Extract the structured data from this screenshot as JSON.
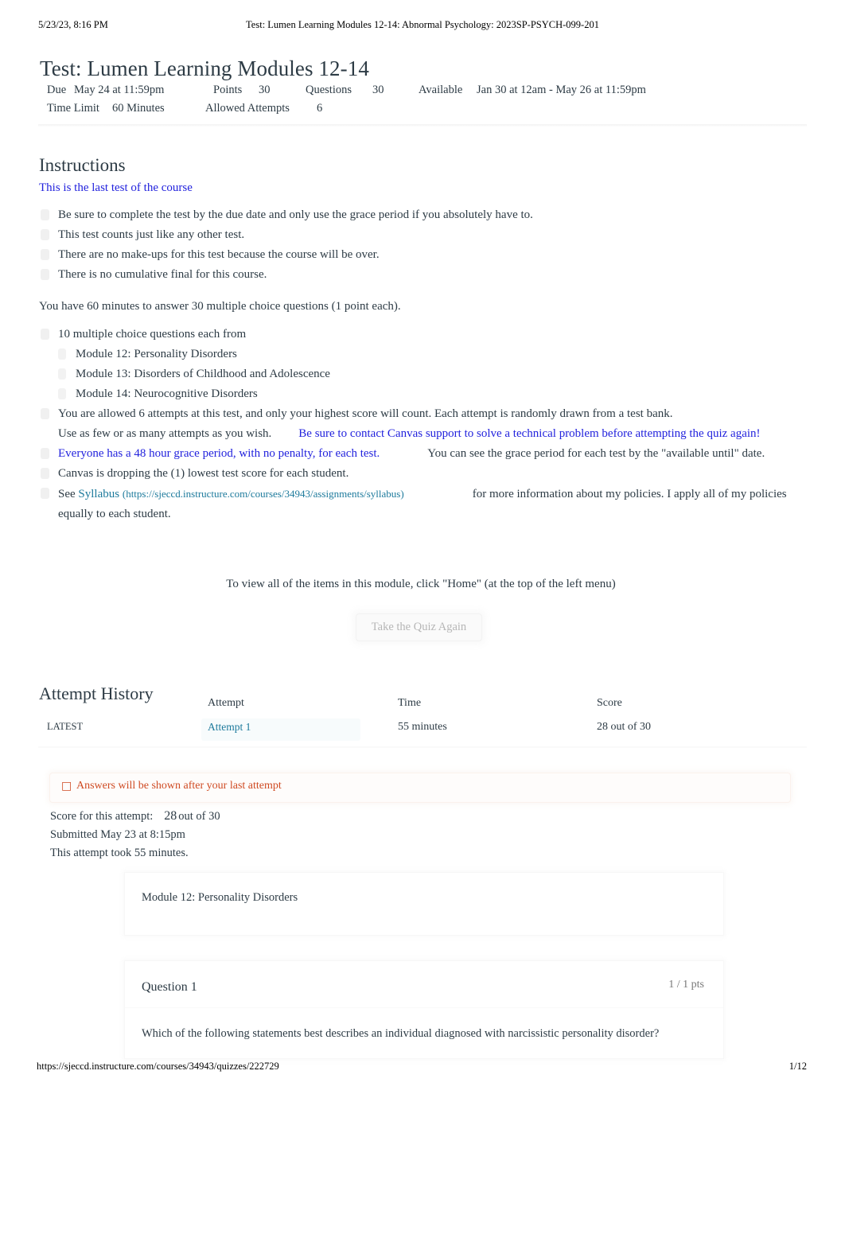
{
  "print_header": {
    "timestamp": "5/23/23, 8:16 PM",
    "doc_title": "Test: Lumen Learning Modules 12-14: Abnormal Psychology: 2023SP-PSYCH-099-201"
  },
  "page_title": "Test: Lumen Learning Modules 12-14",
  "meta": {
    "due_label": "Due",
    "due_value": "May 24 at 11:59pm",
    "points_label": "Points",
    "points_value": "30",
    "questions_label": "Questions",
    "questions_value": "30",
    "available_label": "Available",
    "available_value": "Jan 30 at 12am - May 26 at 11:59pm",
    "time_limit_label": "Time Limit",
    "time_limit_value": "60 Minutes",
    "allowed_attempts_label": "Allowed Attempts",
    "allowed_attempts_value": "6"
  },
  "instructions": {
    "heading": "Instructions",
    "lead": "This is the last test of the course",
    "bullets_1": [
      "Be sure to complete the test by the due date and only use the grace period if you absolutely have to.",
      "This test counts just like any other test.",
      "There are no make-ups for this test because the course will be over.",
      "There is no cumulative final for this course."
    ],
    "paragraph": "You have 60 minutes to answer 30 multiple choice questions (1 point each).",
    "mc_heading": "10 multiple choice questions each from",
    "modules": [
      "Module 12: Personality Disorders",
      "Module 13: Disorders of Childhood and Adolescence",
      "Module 14: Neurocognitive Disorders"
    ],
    "attempts_line": "You are allowed 6 attempts at this test, and only your highest score will count. Each attempt is randomly drawn from a test bank.",
    "use_attempts_text": "Use as few or as many attempts as you wish.",
    "canvas_support_link": "Be sure to contact Canvas support to solve a technical problem before attempting the quiz again!",
    "grace_period_link": "Everyone has a 48 hour grace period, with no penalty, for each test.",
    "grace_period_rest": "You can see the grace period for each test by the \"available until\" date.",
    "dropping_line": "Canvas is dropping the (1) lowest test score for each student.",
    "see_label": "See",
    "syllabus_link_text": "Syllabus",
    "syllabus_url": "(https://sjeccd.instructure.com/courses/34943/assignments/syllabus)",
    "syllabus_rest": "for more information about my policies. I apply all of my policies equally to each student.",
    "center_note": "To view all of the items in this module, click \"Home\" (at the top of the left menu)"
  },
  "take_quiz_button": "Take the Quiz Again",
  "attempt_history": {
    "heading": "Attempt History",
    "columns": {
      "blank": "",
      "attempt": "Attempt",
      "time": "Time",
      "score": "Score"
    },
    "rows": [
      {
        "badge": "LATEST",
        "attempt": "Attempt 1",
        "time": "55 minutes",
        "score": "28 out of 30"
      }
    ]
  },
  "alert": {
    "icon": "warning-tofu-glyph",
    "text": "Answers will be shown after your last attempt",
    "color": "#cf4a22"
  },
  "attempt_summary": {
    "score_label": "Score for this attempt:",
    "score_value": "28",
    "score_suffix": "out of 30",
    "submitted": "Submitted May 23 at 8:15pm",
    "duration": "This attempt took 55 minutes."
  },
  "module_box": {
    "label": "Module 12: Personality Disorders"
  },
  "question": {
    "title": "Question 1",
    "points": "1 / 1 pts",
    "text": "Which of the following statements best describes an individual diagnosed with narcissistic personality disorder?"
  },
  "print_footer": {
    "url": "https://sjeccd.instructure.com/courses/34943/quizzes/222729",
    "page": "1/12"
  },
  "colors": {
    "link_blue": "#2222dd",
    "link_teal": "#1d7a9c",
    "alert_orange": "#cf4a22",
    "text": "#2d3b45"
  }
}
